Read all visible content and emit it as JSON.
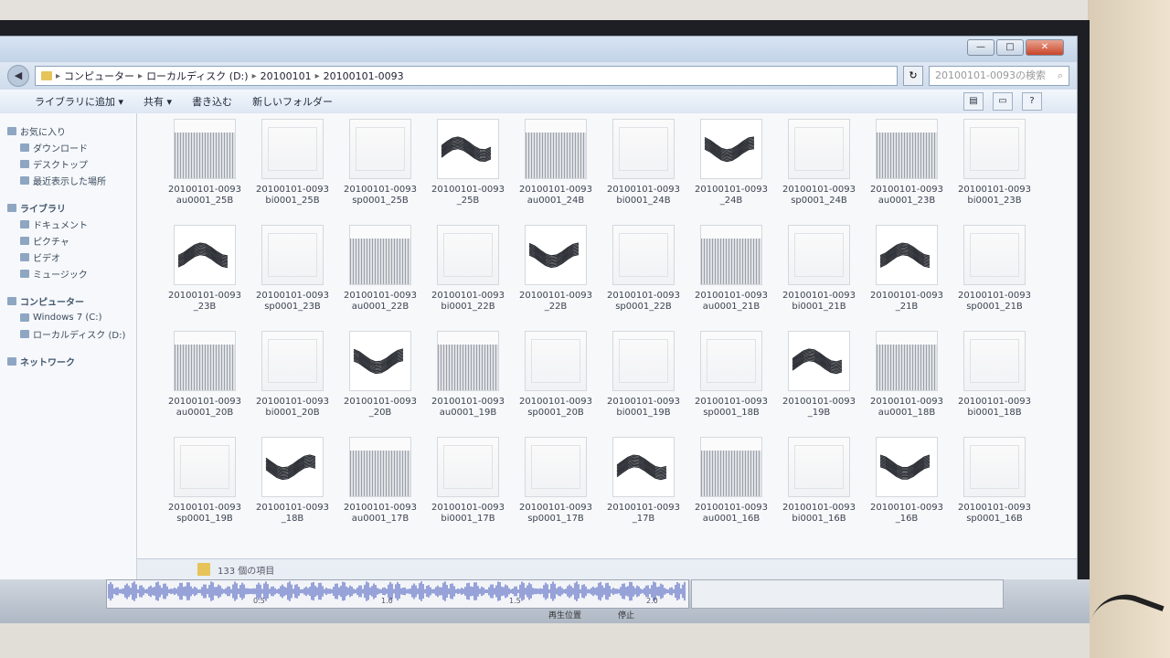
{
  "window": {
    "min_label": "—",
    "max_label": "□",
    "close_label": "✕"
  },
  "address": {
    "segments": [
      "コンピューター",
      "ローカルディスク (D:)",
      "20100101",
      "20100101-0093"
    ],
    "search_placeholder": "20100101-0093の検索"
  },
  "toolbar": {
    "items": [
      "ライブラリに追加 ▾",
      "共有 ▾",
      "書き込む",
      "新しいフォルダー"
    ]
  },
  "nav": {
    "favorites": "お気に入り",
    "favorites_items": [
      "ダウンロード",
      "デスクトップ",
      "最近表示した場所"
    ],
    "libraries": "ライブラリ",
    "libraries_items": [
      "ドキュメント",
      "ピクチャ",
      "ビデオ",
      "ミュージック"
    ],
    "computer": "コンピューター",
    "computer_items": [
      "Windows 7 (C:)",
      "ローカルディスク (D:)"
    ],
    "network": "ネットワーク"
  },
  "files": [
    {
      "name": "20100101-0093 au0001_25B",
      "kind": "dense"
    },
    {
      "name": "20100101-0093 bi0001_25B",
      "kind": "plain"
    },
    {
      "name": "20100101-0093 sp0001_25B",
      "kind": "plain"
    },
    {
      "name": "20100101-0093 _25B",
      "kind": "wave"
    },
    {
      "name": "20100101-0093 au0001_24B",
      "kind": "dense"
    },
    {
      "name": "20100101-0093 bi0001_24B",
      "kind": "plain"
    },
    {
      "name": "20100101-0093 _24B",
      "kind": "wave"
    },
    {
      "name": "20100101-0093 sp0001_24B",
      "kind": "plain"
    },
    {
      "name": "20100101-0093 au0001_23B",
      "kind": "dense"
    },
    {
      "name": "20100101-0093 bi0001_23B",
      "kind": "plain"
    },
    {
      "name": "20100101-0093 _23B",
      "kind": "wave"
    },
    {
      "name": "20100101-0093 sp0001_23B",
      "kind": "plain"
    },
    {
      "name": "20100101-0093 au0001_22B",
      "kind": "dense"
    },
    {
      "name": "20100101-0093 bi0001_22B",
      "kind": "plain"
    },
    {
      "name": "20100101-0093 _22B",
      "kind": "wave"
    },
    {
      "name": "20100101-0093 sp0001_22B",
      "kind": "plain"
    },
    {
      "name": "20100101-0093 au0001_21B",
      "kind": "dense"
    },
    {
      "name": "20100101-0093 bi0001_21B",
      "kind": "plain"
    },
    {
      "name": "20100101-0093 _21B",
      "kind": "wave"
    },
    {
      "name": "20100101-0093 sp0001_21B",
      "kind": "plain"
    },
    {
      "name": "20100101-0093 au0001_20B",
      "kind": "dense"
    },
    {
      "name": "20100101-0093 bi0001_20B",
      "kind": "plain"
    },
    {
      "name": "20100101-0093 _20B",
      "kind": "wave"
    },
    {
      "name": "20100101-0093 au0001_19B",
      "kind": "dense"
    },
    {
      "name": "20100101-0093 sp0001_20B",
      "kind": "plain"
    },
    {
      "name": "20100101-0093 bi0001_19B",
      "kind": "plain"
    },
    {
      "name": "20100101-0093 sp0001_18B",
      "kind": "plain"
    },
    {
      "name": "20100101-0093 _19B",
      "kind": "wave"
    },
    {
      "name": "20100101-0093 au0001_18B",
      "kind": "dense"
    },
    {
      "name": "20100101-0093 bi0001_18B",
      "kind": "plain"
    },
    {
      "name": "20100101-0093 sp0001_19B",
      "kind": "plain"
    },
    {
      "name": "20100101-0093 _18B",
      "kind": "wave"
    },
    {
      "name": "20100101-0093 au0001_17B",
      "kind": "dense"
    },
    {
      "name": "20100101-0093 bi0001_17B",
      "kind": "plain"
    },
    {
      "name": "20100101-0093 sp0001_17B",
      "kind": "plain"
    },
    {
      "name": "20100101-0093 _17B",
      "kind": "wave"
    },
    {
      "name": "20100101-0093 au0001_16B",
      "kind": "dense"
    },
    {
      "name": "20100101-0093 bi0001_16B",
      "kind": "plain"
    },
    {
      "name": "20100101-0093 _16B",
      "kind": "wave"
    },
    {
      "name": "20100101-0093 sp0001_16B",
      "kind": "plain"
    }
  ],
  "status": {
    "count_text": "133 個の項目"
  },
  "taskbar": {
    "audio_marks": [
      "0.5",
      "1.0",
      "1.5",
      "2.0"
    ],
    "labels": [
      "再生位置",
      "停止"
    ]
  }
}
